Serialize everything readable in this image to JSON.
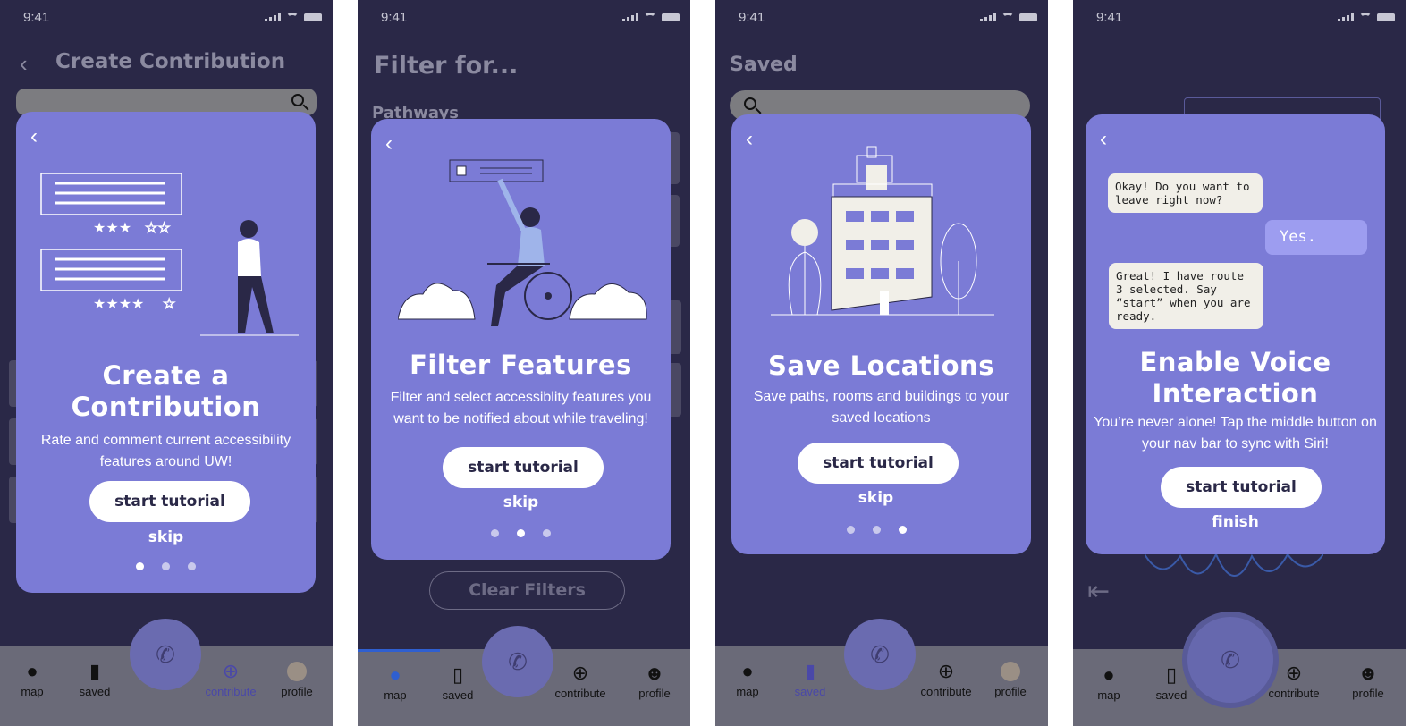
{
  "status_time": "9:41",
  "nav": {
    "map": "map",
    "saved": "saved",
    "contribute": "contribute",
    "profile": "profile"
  },
  "screens": [
    {
      "bg_title": "Create Contribution",
      "modal": {
        "title_line1": "Create a",
        "title_line2": "Contribution",
        "description": "Rate and comment current accessibility features around UW!",
        "cta": "start tutorial",
        "secondary": "skip",
        "active_dot": 1
      }
    },
    {
      "bg_title": "Filter for...",
      "bg_subtitle": "Pathways",
      "bg_button": "Clear Filters",
      "modal": {
        "title": "Filter Features",
        "description": "Filter and select accessiblity features you want to be notified about while traveling!",
        "cta": "start tutorial",
        "secondary": "skip",
        "active_dot": 2
      }
    },
    {
      "bg_title": "Saved",
      "modal": {
        "title": "Save Locations",
        "description": "Save paths, rooms and buildings to your saved locations",
        "cta": "start tutorial",
        "secondary": "skip",
        "active_dot": 3
      }
    },
    {
      "modal": {
        "title_line1": "Enable Voice",
        "title_line2": "Interaction",
        "description": "You’re never alone! Tap the middle button on your nav bar to sync with Siri!",
        "cta": "start tutorial",
        "secondary": "finish",
        "chat": {
          "msg1": "Okay! Do you want to leave right now?",
          "msg2": "Yes.",
          "msg3": "Great! I have route 3 selected. Say “start” when you are ready."
        }
      }
    }
  ],
  "colors": {
    "background": "#2a2847",
    "modal": "#7b7bd6",
    "navbar": "#6a6a78",
    "active_nav": "#4a48a8",
    "siri_button": "#6a6bb0"
  },
  "icons": [
    "back-chevron-icon",
    "search-icon",
    "map-pin-icon",
    "bookmark-icon",
    "plus-circle-icon",
    "person-icon",
    "voice-icon",
    "exit-icon"
  ]
}
